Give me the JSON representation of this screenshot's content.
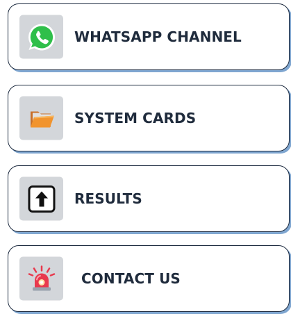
{
  "menu": {
    "items": [
      {
        "label": "WHATSAPP CHANNEL",
        "icon": "whatsapp-icon",
        "icon_color": "#2fbf4a"
      },
      {
        "label": "SYSTEM CARDS",
        "icon": "folder-icon",
        "icon_color": "#f1942e"
      },
      {
        "label": "RESULTS",
        "icon": "up-arrow-icon",
        "icon_color": "#111111"
      },
      {
        "label": "CONTACT US",
        "icon": "siren-icon",
        "icon_color": "#e8394d"
      }
    ]
  },
  "colors": {
    "card_border": "#1c2a3f",
    "card_shadow": "#7fa6d0",
    "icon_tile": "#d3d6da",
    "label_text": "#1f2b3c"
  }
}
